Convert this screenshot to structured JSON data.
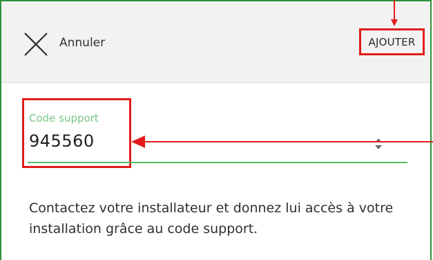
{
  "header": {
    "close_icon": "close-x-icon",
    "cancel_label": "Annuler",
    "add_label": "AJOUTER"
  },
  "form": {
    "field_label": "Code support",
    "field_value": "945560",
    "stepper_icon": "number-stepper-icon"
  },
  "description": "Contactez votre installateur et donnez lui accès à votre installation grâce au code support.",
  "colors": {
    "frame_border": "#2e8f3a",
    "header_bg": "#f2f2f2",
    "highlight": "#e31b1b",
    "field_label": "#79c587",
    "field_underline": "#4cbf63",
    "annotation_arrow": "#e31b1b"
  }
}
